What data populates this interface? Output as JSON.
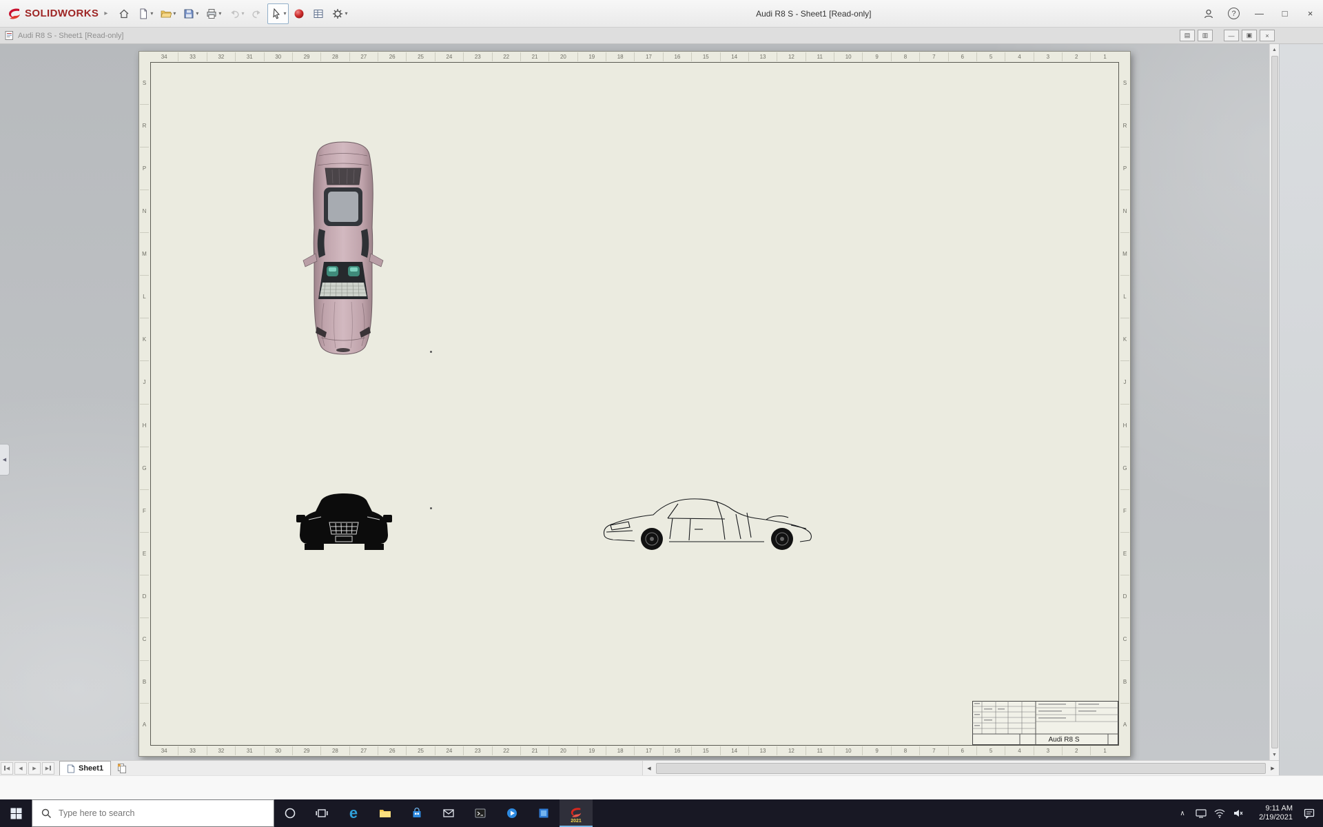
{
  "app": {
    "brand": "SOLIDWORKS",
    "title": "Audi R8 S - Sheet1 [Read-only]",
    "doc_title": "Audi R8 S - Sheet1 [Read-only]"
  },
  "glyphs": {
    "flyout": "▸",
    "caret": "▾",
    "help": "?",
    "minimize": "—",
    "maximize": "□",
    "close": "×",
    "pane_left": "▤",
    "pane_right": "▥",
    "doc_restore": "▣",
    "left": "◀",
    "right": "▶",
    "up": "▲",
    "down": "▼",
    "chevron_up": "∧",
    "edge": "e"
  },
  "sheet": {
    "zone_numbers": [
      "34",
      "33",
      "32",
      "31",
      "30",
      "29",
      "28",
      "27",
      "26",
      "25",
      "24",
      "23",
      "22",
      "21",
      "20",
      "19",
      "18",
      "17",
      "16",
      "15",
      "14",
      "13",
      "12",
      "11",
      "10",
      "9",
      "8",
      "7",
      "6",
      "5",
      "4",
      "3",
      "2",
      "1"
    ],
    "zone_letters": [
      "S",
      "R",
      "P",
      "N",
      "M",
      "L",
      "K",
      "J",
      "H",
      "G",
      "F",
      "E",
      "D",
      "C",
      "B",
      "A"
    ],
    "title_block_name": "Audi R8 S"
  },
  "tabs": {
    "sheet1": "Sheet1"
  },
  "taskbar": {
    "search_placeholder": "Type here to search",
    "sw_badge": "2021",
    "time": "9:11 AM",
    "date": "2/19/2021"
  }
}
